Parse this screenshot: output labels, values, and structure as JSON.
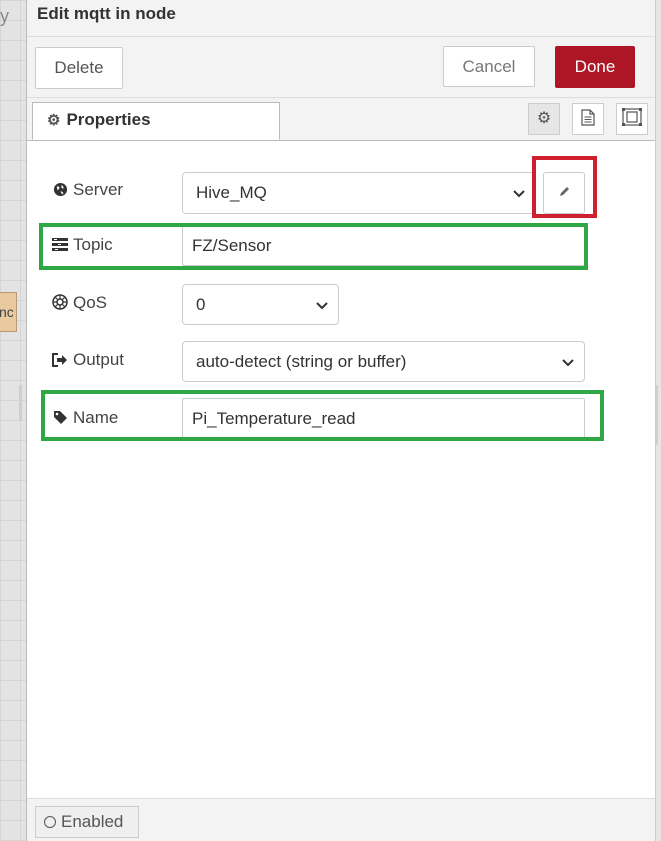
{
  "background": {
    "letter": "y",
    "node_fragment": "nc"
  },
  "tray": {
    "title": "Edit mqtt in node",
    "toolbar": {
      "delete_label": "Delete",
      "cancel_label": "Cancel",
      "done_label": "Done"
    },
    "tabs": [
      {
        "label": "Properties",
        "icon": "gear-icon",
        "active": true
      }
    ],
    "tab_icons": [
      "gear-icon",
      "file-text-icon",
      "appearance-icon"
    ],
    "form": {
      "server": {
        "label": "Server",
        "icon": "globe-icon",
        "value": "Hive_MQ",
        "edit_icon": "pencil-icon"
      },
      "topic": {
        "label": "Topic",
        "icon": "tasks-icon",
        "value": "FZ/Sensor"
      },
      "qos": {
        "label": "QoS",
        "icon": "empire-icon",
        "value": "0"
      },
      "output": {
        "label": "Output",
        "icon": "sign-out-icon",
        "value": "auto-detect (string or buffer)"
      },
      "name": {
        "label": "Name",
        "icon": "tag-icon",
        "value": "Pi_Temperature_read"
      }
    },
    "footer": {
      "enabled_label": "Enabled"
    }
  },
  "colors": {
    "done_button": "#ad1625",
    "highlight_red": "#d0202f",
    "highlight_green": "#2ea744"
  }
}
